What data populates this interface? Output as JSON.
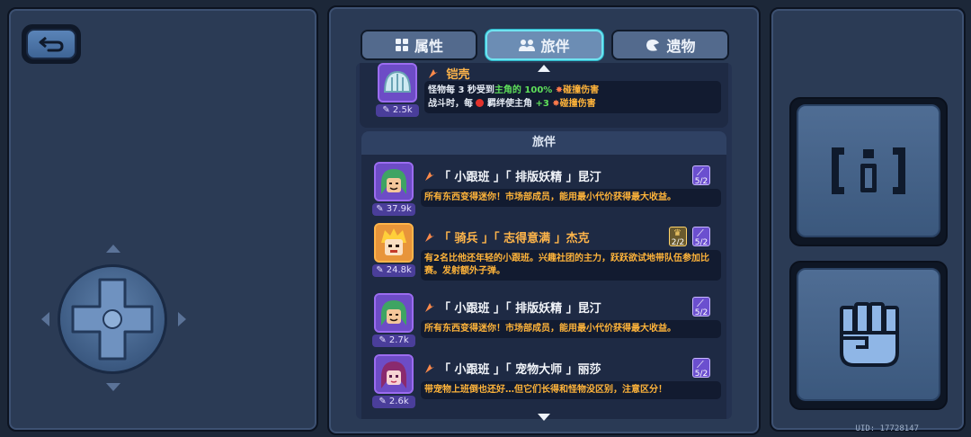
{
  "tabs": [
    {
      "label": "属性",
      "icon": "grid-icon"
    },
    {
      "label": "旅伴",
      "icon": "people-icon"
    },
    {
      "label": "遗物",
      "icon": "relic-icon"
    }
  ],
  "active_tab": "旅伴",
  "top_item": {
    "name": "铠壳",
    "power": "2.5k",
    "line1_prefix": "怪物每 3 秒受到",
    "line1_highlight": "主角的 100%",
    "line1_suffix": "碰撞伤害",
    "line2_prefix": "战斗时，每",
    "line2_middle": "羁绊使主角",
    "line2_highlight": "+3",
    "line2_suffix": "碰撞伤害"
  },
  "section_title": "旅伴",
  "companions": [
    {
      "name": "「 小跟班 」「 排版妖精 」昆汀",
      "power": "37.9k",
      "desc": "所有东西变得迷你！市场部成员，能用最小代价获得最大收益。",
      "slots": [
        "5/2"
      ],
      "frame": "purple"
    },
    {
      "name": "「 骑兵 」「 志得意满 」杰克",
      "power": "24.8k",
      "desc": "有2名比他还年轻的小跟班。兴趣社团的主力，跃跃欲试地带队伍参加比赛。发射额外子弹。",
      "slots": [
        "2/2",
        "5/2"
      ],
      "frame": "orange"
    },
    {
      "name": "「 小跟班 」「 排版妖精 」昆汀",
      "power": "2.7k",
      "desc": "所有东西变得迷你！市场部成员，能用最小代价获得最大收益。",
      "slots": [
        "5/2"
      ],
      "frame": "purple"
    },
    {
      "name": "「 小跟班 」「 宠物大师 」丽莎",
      "power": "2.6k",
      "desc": "带宠物上班倒也还好…但它们长得和怪物没区别，注意区分！",
      "slots": [
        "5/2"
      ],
      "frame": "purple"
    }
  ],
  "uid": "UID: 17728147",
  "colors": {
    "accent_cyan": "#6ee3f0",
    "highlight_green": "#5fe05a",
    "desc_orange": "#ffb43a",
    "name_orange": "#ffb54a"
  }
}
